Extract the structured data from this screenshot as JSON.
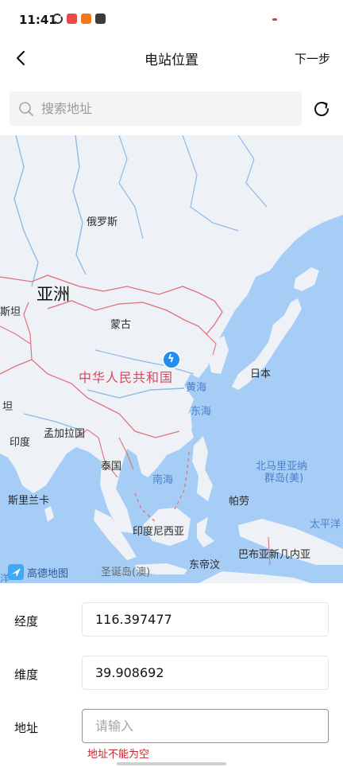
{
  "status_bar": {
    "time": "11:41",
    "icons": [
      "sync-icon",
      "app-red-icon",
      "app-orange-icon",
      "app-dark-icon"
    ]
  },
  "nav": {
    "title": "电站位置",
    "next_label": "下一步",
    "back_icon": "chevron-left-icon"
  },
  "search": {
    "placeholder": "搜索地址",
    "value": "",
    "icon": "search-icon",
    "refresh_icon": "refresh-icon"
  },
  "map": {
    "labels": {
      "russia": "俄罗斯",
      "asia": "亚洲",
      "stan": "斯坦",
      "mongolia": "蒙古",
      "china": "中华人民共和国",
      "japan": "日本",
      "yellow_sea": "黄海",
      "east_sea": "东海",
      "tan": "坦",
      "bangladesh": "孟加拉国",
      "india": "印度",
      "thailand": "泰国",
      "south_sea": "南海",
      "n_mariana": "北马里亚纳",
      "n_mariana2": "群岛(美)",
      "palau": "帕劳",
      "sri_lanka": "斯里兰卡",
      "indonesia": "印度尼西亚",
      "pacific": "太平洋",
      "png": "巴布亚新几内亚",
      "christmas": "圣诞岛(澳)",
      "timor": "东帝汶",
      "ocean": "洋"
    },
    "provider_logo": "高德地图",
    "marker_icon": "station-marker-icon",
    "colors": {
      "water": "#a6cdf5",
      "land": "#eef2f6",
      "border": "#e0707a",
      "river": "#8fb9e8"
    }
  },
  "form": {
    "longitude": {
      "label": "经度",
      "value": "116.397477"
    },
    "latitude": {
      "label": "维度",
      "value": "39.908692"
    },
    "address": {
      "label": "地址",
      "value": "",
      "placeholder": "请输入",
      "error": "地址不能为空"
    }
  }
}
